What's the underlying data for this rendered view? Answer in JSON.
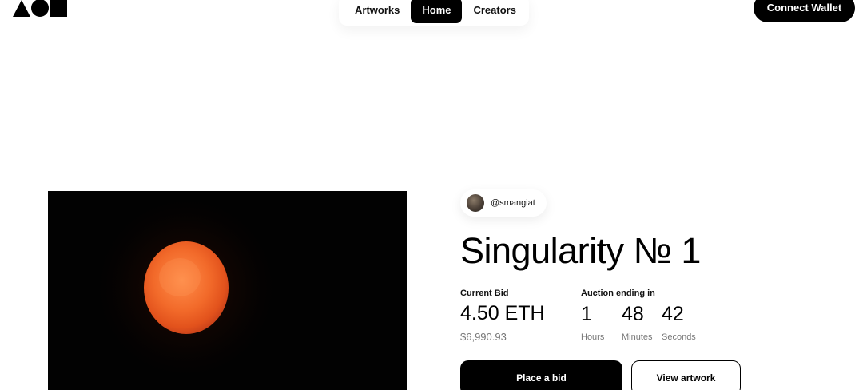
{
  "header": {
    "logo_name": "shapes-logo",
    "nav": [
      {
        "label": "Artworks",
        "active": false
      },
      {
        "label": "Home",
        "active": true
      },
      {
        "label": "Creators",
        "active": false
      }
    ],
    "connect_label": "Connect Wallet"
  },
  "artwork": {
    "subject": "orange sun on black background"
  },
  "info": {
    "creator_handle": "@smangiat",
    "title": "Singularity № 1",
    "current_bid_label": "Current Bid",
    "current_bid_value": "4.50 ETH",
    "current_bid_usd": "$6,990.93",
    "auction_label": "Auction ending in",
    "countdown": [
      {
        "value": "1",
        "unit": "Hours"
      },
      {
        "value": "48",
        "unit": "Minutes"
      },
      {
        "value": "42",
        "unit": "Seconds"
      }
    ],
    "place_bid_label": "Place a bid",
    "view_artwork_label": "View artwork"
  },
  "colors": {
    "accent": "#000000",
    "sun": "#f26a2a",
    "muted_text": "#777777"
  }
}
